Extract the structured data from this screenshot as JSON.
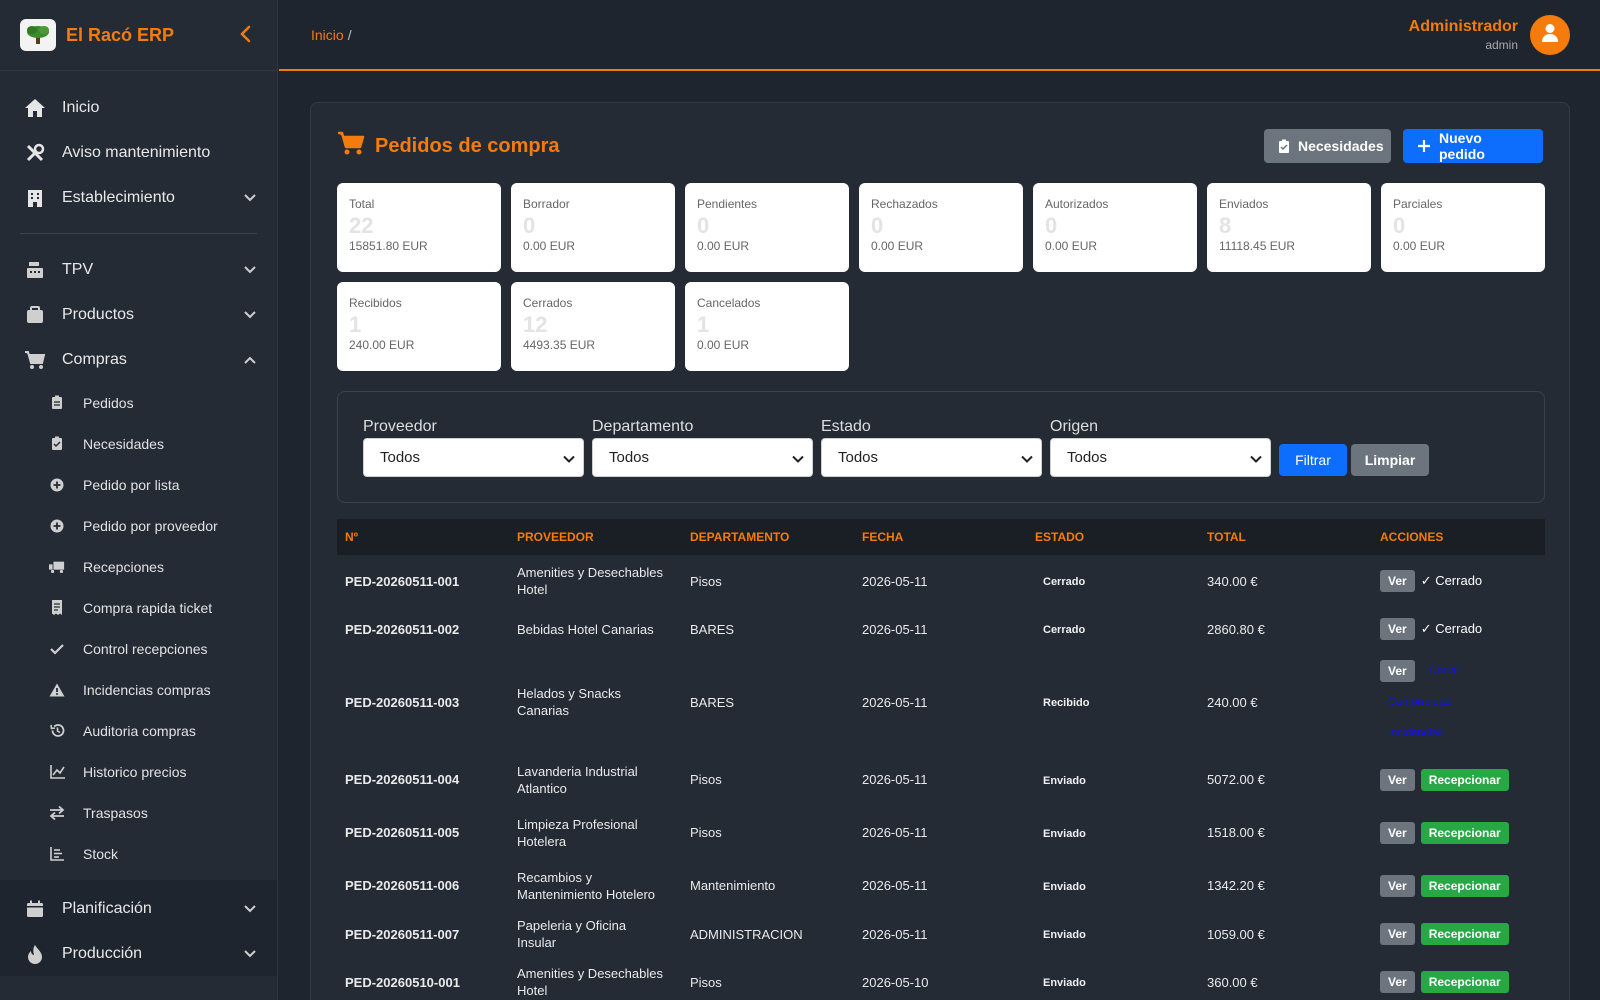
{
  "app": {
    "title": "El Racó ERP"
  },
  "breadcrumb": {
    "home": "Inicio",
    "separator": "/"
  },
  "user": {
    "name": "Administrador",
    "role": "admin"
  },
  "sidebar": {
    "top_items": [
      {
        "label": "Inicio",
        "icon": "home-icon"
      },
      {
        "label": "Aviso mantenimiento",
        "icon": "tools-icon"
      },
      {
        "label": "Establecimiento",
        "icon": "building-icon"
      }
    ],
    "group_items": [
      {
        "label": "TPV",
        "icon": "cash-register-icon"
      },
      {
        "label": "Productos",
        "icon": "box-icon"
      },
      {
        "label": "Compras",
        "icon": "cart-icon"
      }
    ],
    "compras_sub": [
      {
        "label": "Pedidos",
        "icon": "clipboard-icon"
      },
      {
        "label": "Necesidades",
        "icon": "clipboard-check-icon"
      },
      {
        "label": "Pedido por lista",
        "icon": "plus-circle-icon"
      },
      {
        "label": "Pedido por proveedor",
        "icon": "plus-circle-icon"
      },
      {
        "label": "Recepciones",
        "icon": "truck-icon"
      },
      {
        "label": "Compra rapida ticket",
        "icon": "receipt-icon"
      },
      {
        "label": "Control recepciones",
        "icon": "check-icon"
      },
      {
        "label": "Incidencias compras",
        "icon": "warning-icon"
      },
      {
        "label": "Auditoria compras",
        "icon": "history-icon"
      },
      {
        "label": "Historico precios",
        "icon": "chart-line-icon"
      },
      {
        "label": "Traspasos",
        "icon": "exchange-icon"
      },
      {
        "label": "Stock",
        "icon": "stock-list-icon"
      }
    ],
    "bottom_items": [
      {
        "label": "Planificación",
        "icon": "calendar-icon"
      },
      {
        "label": "Producción",
        "icon": "flame-icon"
      }
    ]
  },
  "page": {
    "title": "Pedidos de compra",
    "btn_needs": "Necesidades",
    "btn_new": "Nuevo pedido"
  },
  "stats": [
    {
      "label": "Total",
      "count": "22",
      "amount": "15851.80 EUR"
    },
    {
      "label": "Borrador",
      "count": "0",
      "amount": "0.00 EUR"
    },
    {
      "label": "Pendientes",
      "count": "0",
      "amount": "0.00 EUR"
    },
    {
      "label": "Rechazados",
      "count": "0",
      "amount": "0.00 EUR"
    },
    {
      "label": "Autorizados",
      "count": "0",
      "amount": "0.00 EUR"
    },
    {
      "label": "Enviados",
      "count": "8",
      "amount": "11118.45 EUR"
    },
    {
      "label": "Parciales",
      "count": "0",
      "amount": "0.00 EUR"
    },
    {
      "label": "Recibidos",
      "count": "1",
      "amount": "240.00 EUR"
    },
    {
      "label": "Cerrados",
      "count": "12",
      "amount": "4493.35 EUR"
    },
    {
      "label": "Cancelados",
      "count": "1",
      "amount": "0.00 EUR"
    }
  ],
  "filters": {
    "proveedor": {
      "label": "Proveedor",
      "value": "Todos"
    },
    "departamento": {
      "label": "Departamento",
      "value": "Todos"
    },
    "estado": {
      "label": "Estado",
      "value": "Todos"
    },
    "origen": {
      "label": "Origen",
      "value": "Todos"
    },
    "btn_filter": "Filtrar",
    "btn_clear": "Limpiar"
  },
  "table": {
    "headers": [
      "Nº",
      "PROVEEDOR",
      "DEPARTAMENTO",
      "FECHA",
      "ESTADO",
      "TOTAL",
      "ACCIONES"
    ],
    "btn_view": "Ver",
    "btn_receive": "Recepcionar",
    "closed_label": "✓ Cerrado",
    "link_close": "Cerrar",
    "link_conformity": "Conformidad",
    "link_incidents": "Incidencias",
    "rows": [
      {
        "num": "PED-20260511-001",
        "proveedor": "Amenities y Desechables Hotel",
        "departamento": "Pisos",
        "fecha": "2026-05-11",
        "estado": "Cerrado",
        "total": "340.00 €"
      },
      {
        "num": "PED-20260511-002",
        "proveedor": "Bebidas Hotel Canarias",
        "departamento": "BARES",
        "fecha": "2026-05-11",
        "estado": "Cerrado",
        "total": "2860.80 €"
      },
      {
        "num": "PED-20260511-003",
        "proveedor": "Helados y Snacks Canarias",
        "departamento": "BARES",
        "fecha": "2026-05-11",
        "estado": "Recibido",
        "total": "240.00 €"
      },
      {
        "num": "PED-20260511-004",
        "proveedor": "Lavanderia Industrial Atlantico",
        "departamento": "Pisos",
        "fecha": "2026-05-11",
        "estado": "Enviado",
        "total": "5072.00 €"
      },
      {
        "num": "PED-20260511-005",
        "proveedor": "Limpieza Profesional Hotelera",
        "departamento": "Pisos",
        "fecha": "2026-05-11",
        "estado": "Enviado",
        "total": "1518.00 €"
      },
      {
        "num": "PED-20260511-006",
        "proveedor": "Recambios y Mantenimiento Hotelero",
        "departamento": "Mantenimiento",
        "fecha": "2026-05-11",
        "estado": "Enviado",
        "total": "1342.20 €"
      },
      {
        "num": "PED-20260511-007",
        "proveedor": "Papeleria y Oficina Insular",
        "departamento": "ADMINISTRACION",
        "fecha": "2026-05-11",
        "estado": "Enviado",
        "total": "1059.00 €"
      },
      {
        "num": "PED-20260510-001",
        "proveedor": "Amenities y Desechables Hotel",
        "departamento": "Pisos",
        "fecha": "2026-05-10",
        "estado": "Enviado",
        "total": "360.00 €"
      }
    ]
  },
  "colors": {
    "accent": "#f47b0c",
    "primary": "#0d6efd",
    "success": "#28a745",
    "secondary": "#6c757d"
  }
}
